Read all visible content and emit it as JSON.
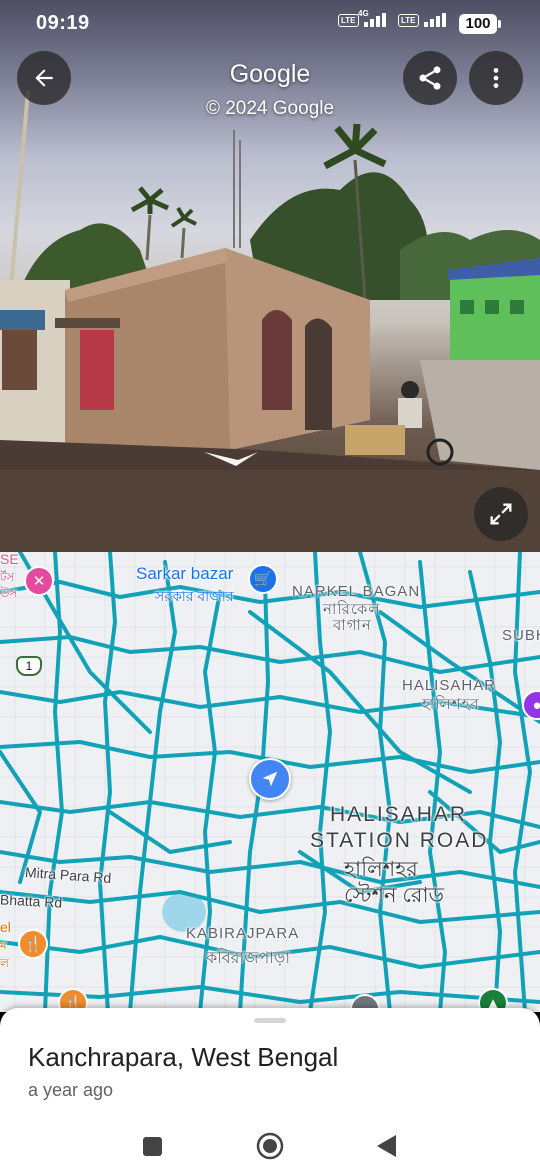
{
  "status_bar": {
    "time": "09:19",
    "sim1_tech": "4G",
    "battery": "100"
  },
  "street_view": {
    "title": "Google",
    "copyright": "© 2024 Google",
    "icons": [
      "back-arrow-icon",
      "share-icon",
      "more-vert-icon",
      "expand-icon"
    ]
  },
  "map": {
    "labels": {
      "sarkar_bazar": "Sarkar bazar",
      "sarkar_bazar_bn": "সরকার বাজার",
      "narkel_bagan": "NARKEL BAGAN",
      "narkel_bagan_bn_1": "নারিকেল",
      "narkel_bagan_bn_2": "বাগান",
      "subh": "SUBH",
      "halisahar": "HALISAHAR",
      "halisahar_bn": "হালিশহর",
      "station_road_1": "HALISAHAR",
      "station_road_2": "STATION ROAD",
      "station_road_bn_1": "হালিশহর",
      "station_road_bn_2": "স্টেশন রোড",
      "mitra_para_rd": "Mitra Para Rd",
      "bhatta_rd": "Bhatta Rd",
      "kabirajpara": "KABIRAJPARA",
      "kabirajpara_bn": "কবিরাজপাড়া",
      "route_shield": "1",
      "edge_left_top_1": "SE",
      "edge_left_top_2": "র্টস",
      "edge_left_top_3": "উস",
      "edge_left_mid_1": "el",
      "edge_left_mid_2": "ম",
      "edge_left_mid_3": "ল"
    },
    "colors": {
      "road": "#12a2b8",
      "background": "#eef0f3",
      "location_marker": "#4285f4",
      "poi_shopping": "#1a73e8",
      "poi_food": "#f28b2c",
      "poi_pink": "#e64a9e",
      "poi_purple": "#9334e6"
    }
  },
  "sheet": {
    "place_name": "Kanchrapara, West Bengal",
    "age": "a year ago"
  },
  "nav_bar": {
    "icons": [
      "recents-square-icon",
      "home-circle-icon",
      "back-triangle-icon"
    ]
  }
}
